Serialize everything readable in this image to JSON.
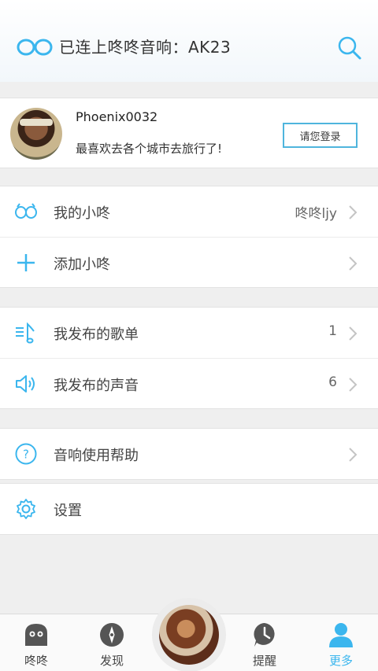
{
  "header": {
    "title": "已连上咚咚音响：AK23",
    "logo_icon": "infinity-icon",
    "search_icon": "search-icon",
    "accent": "#3bb6ee"
  },
  "profile": {
    "name": "Phoenix0032",
    "bio": "最喜欢去各个城市去旅行了!",
    "login_label": "请您登录"
  },
  "menu": {
    "my_device": {
      "label": "我的小咚",
      "value": "咚咚ljy",
      "icon": "infinity-icon"
    },
    "add_device": {
      "label": "添加小咚",
      "icon": "plus-icon"
    },
    "my_playlists": {
      "label": "我发布的歌单",
      "value": "1",
      "icon": "music-note-icon"
    },
    "my_sounds": {
      "label": "我发布的声音",
      "value": "6",
      "icon": "speaker-icon"
    },
    "help": {
      "label": "音响使用帮助",
      "icon": "help-icon"
    },
    "settings": {
      "label": "设置",
      "icon": "gear-icon"
    }
  },
  "tabbar": {
    "tabs": [
      {
        "label": "咚咚",
        "icon": "ghost-icon"
      },
      {
        "label": "发现",
        "icon": "compass-icon"
      },
      {
        "label": "提醒",
        "icon": "clock-icon"
      },
      {
        "label": "更多",
        "icon": "user-icon",
        "active": true
      }
    ],
    "center_icon": "now-playing-disc"
  }
}
